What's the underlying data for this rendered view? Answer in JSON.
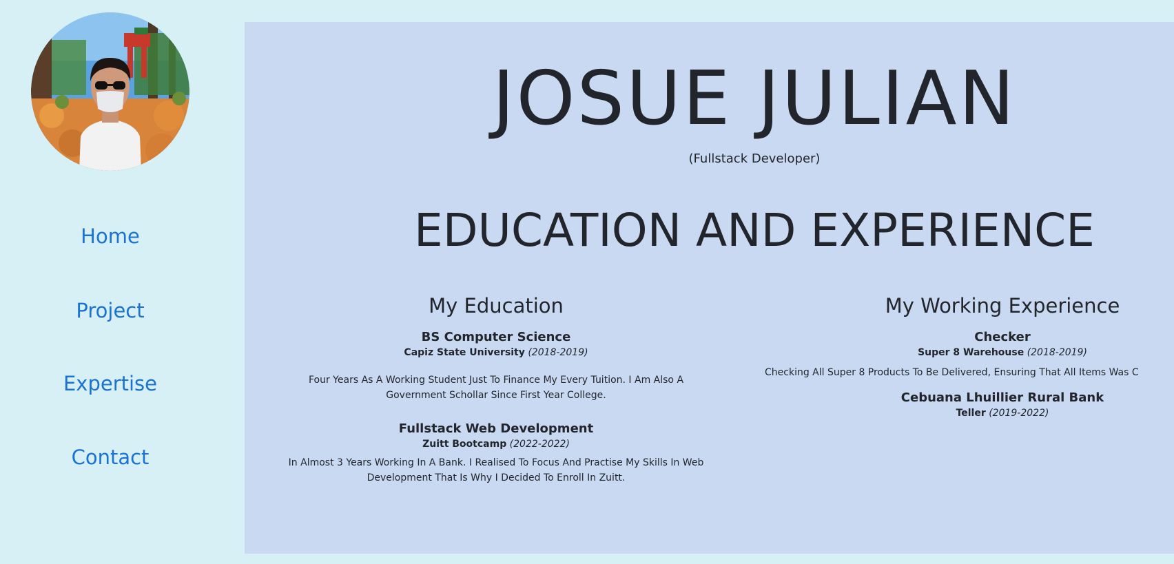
{
  "profile": {
    "name": "JOSUE JULIAN",
    "role": "(Fullstack Developer)"
  },
  "nav": {
    "home": "Home",
    "project": "Project",
    "expertise": "Expertise",
    "contact": "Contact"
  },
  "section": {
    "title": "EDUCATION AND EXPERIENCE"
  },
  "education": {
    "heading": "My Education",
    "items": [
      {
        "title": "BS Computer Science",
        "org": "Capiz State University",
        "period": "(2018-2019)",
        "description": "Four Years As A Working Student Just To Finance My Every Tuition. I Am Also A Government Schollar Since First Year College."
      },
      {
        "title": "Fullstack Web Development",
        "org": "Zuitt Bootcamp",
        "period": "(2022-2022)",
        "description": "In Almost 3 Years Working In A Bank. I Realised To Focus And Practise My Skills In Web Development That Is Why I Decided To Enroll In Zuitt."
      }
    ]
  },
  "experience": {
    "heading": "My Working Experience",
    "items": [
      {
        "title": "Checker",
        "org": "Super 8 Warehouse",
        "period": "(2018-2019)",
        "description": "Checking All Super 8 Products To Be Delivered, Ensuring That All Items Was C"
      },
      {
        "title": "Cebuana Lhuillier Rural Bank",
        "org": "Teller",
        "period": "(2019-2022)"
      }
    ]
  },
  "colors": {
    "page_background": "#d7f0f5",
    "panel_background": "#c8d9f1",
    "nav_link": "#1a73d2",
    "text": "#22262c"
  }
}
